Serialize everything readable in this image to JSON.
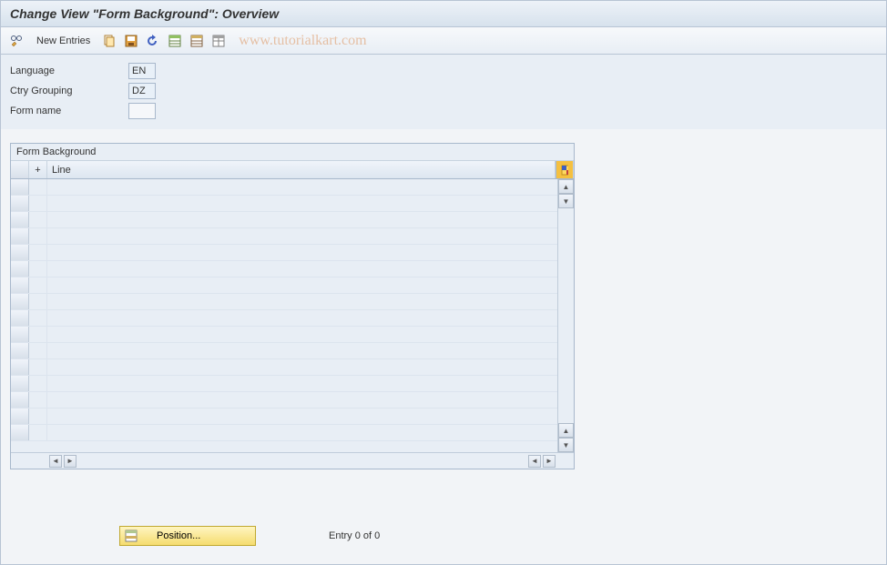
{
  "title": "Change View \"Form Background\": Overview",
  "toolbar": {
    "new_entries_label": "New Entries"
  },
  "watermark": "www.tutorialkart.com",
  "form": {
    "language_label": "Language",
    "language_value": "EN",
    "ctry_grouping_label": "Ctry Grouping",
    "ctry_grouping_value": "DZ",
    "form_name_label": "Form name",
    "form_name_value": ""
  },
  "table": {
    "title": "Form Background",
    "columns": {
      "plus": "+",
      "line": "Line"
    },
    "rows": [
      "",
      "",
      "",
      "",
      "",
      "",
      "",
      "",
      "",
      "",
      "",
      "",
      "",
      "",
      "",
      ""
    ]
  },
  "footer": {
    "position_label": "Position...",
    "entry_text": "Entry 0 of 0"
  }
}
